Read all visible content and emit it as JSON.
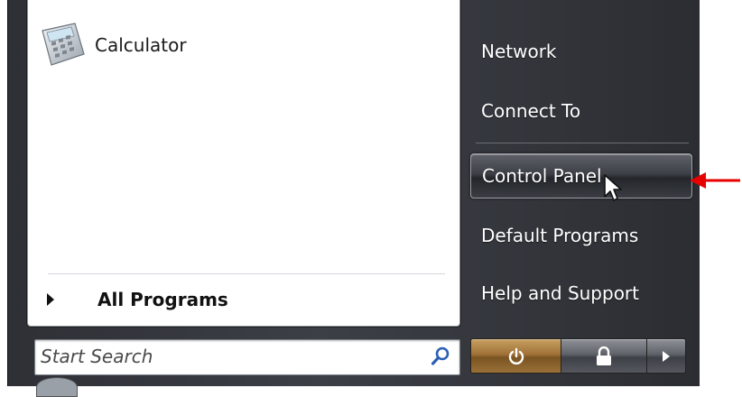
{
  "left_pane": {
    "pinned_programs": [
      {
        "label": "Calculator",
        "icon": "calculator-icon"
      }
    ],
    "all_programs_label": "All Programs"
  },
  "search": {
    "placeholder": "Start Search",
    "icon": "search-icon"
  },
  "right_pane": {
    "items": [
      {
        "label": "Network"
      },
      {
        "label": "Connect To"
      },
      {
        "label": "Control Panel",
        "highlighted": true
      },
      {
        "label": "Default Programs"
      },
      {
        "label": "Help and Support"
      }
    ]
  },
  "bottom_buttons": {
    "power": "power-icon",
    "lock": "lock-icon",
    "more": "arrow-right-icon"
  },
  "colors": {
    "menu_background": "#3c3f46",
    "power_button": "#a07238",
    "annotation_arrow": "#e60000"
  }
}
